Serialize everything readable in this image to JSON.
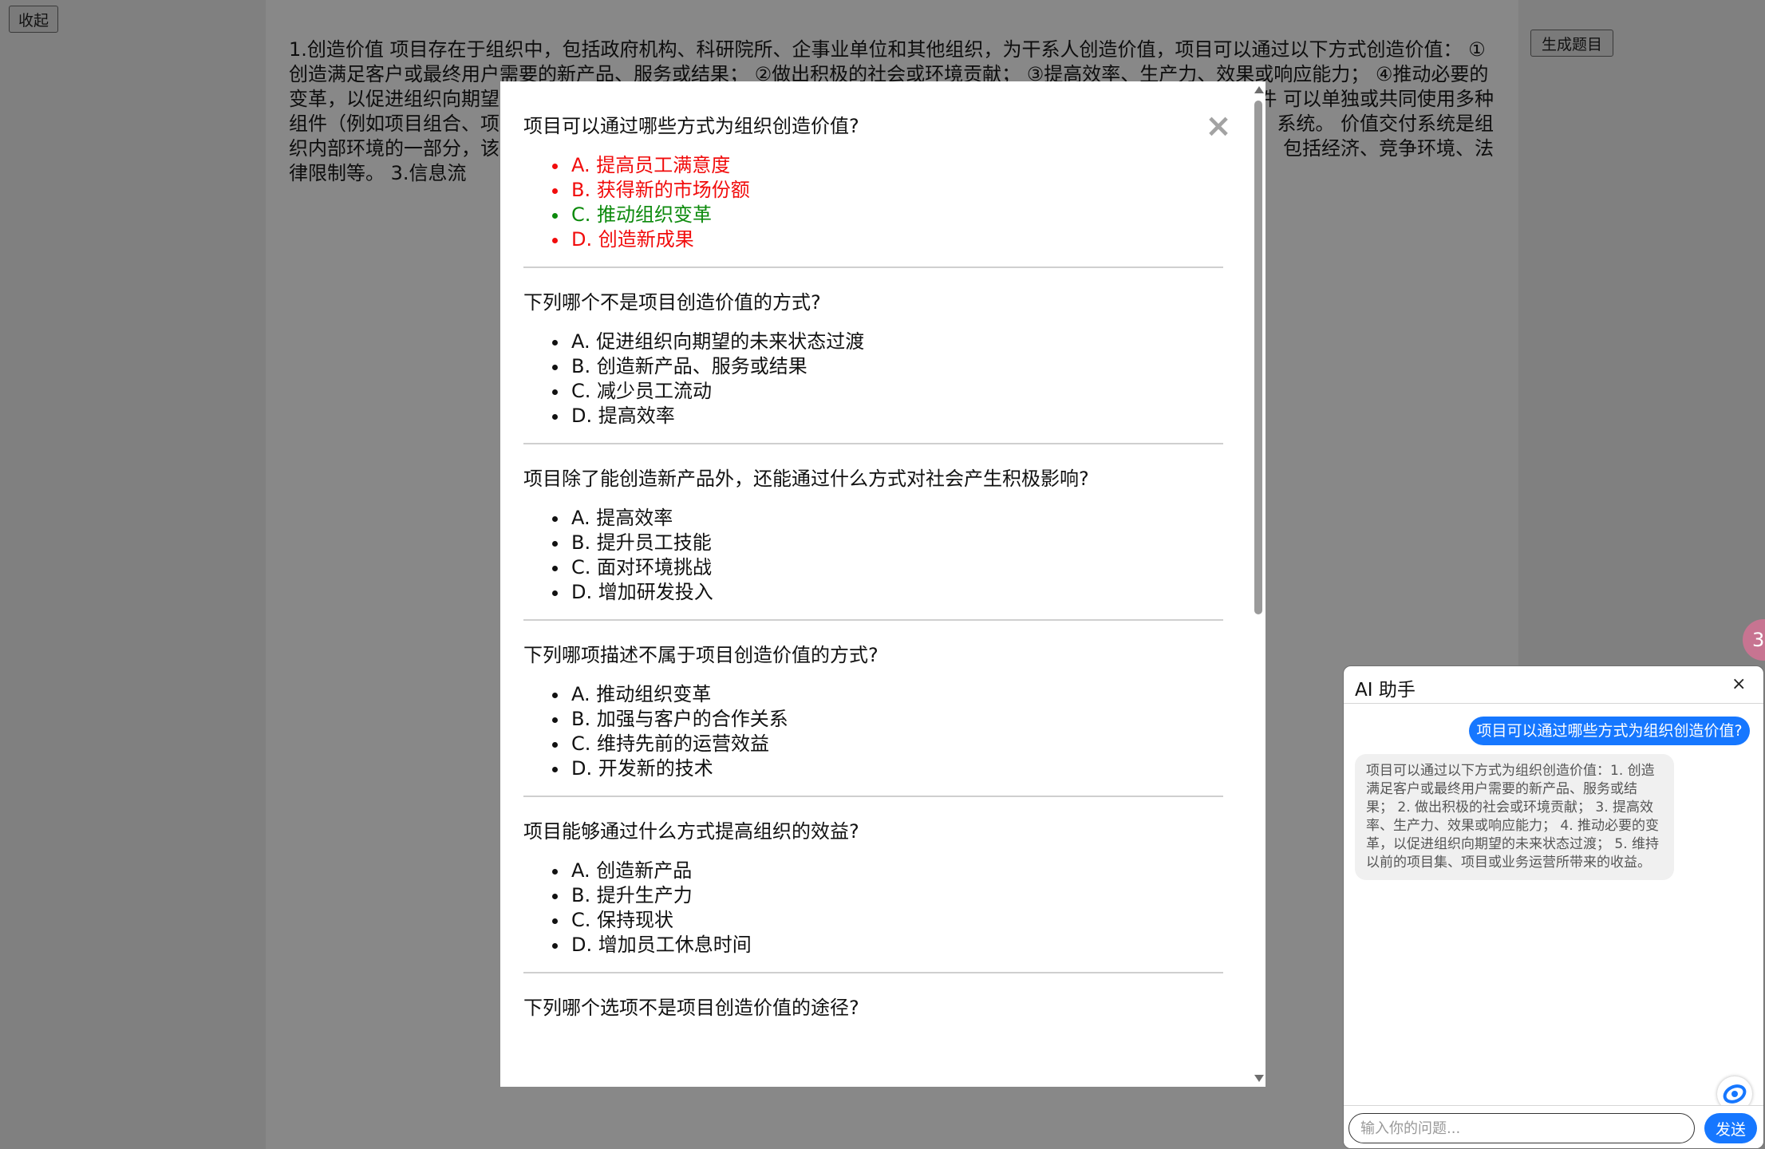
{
  "toolbar": {
    "collapse_label": "收起",
    "generate_label": "生成题目"
  },
  "source_text": "1.创造价值 项目存在于组织中，包括政府机构、科研院所、企事业单位和其他组织，为干系人创造价值，项目可以通过以下方式创造价值： ①创造满足客户或最终用户需要的新产品、服务或结果； ②做出积极的社会或环境贡献； ③提高效率、生产力、效果或响应能力； ④推动必要的变革，以促进组织向期望的未来状态过渡； ⑤维持以前的项目集、项目或业务运营所带来的收益。 2.价值交付系统 价值交付系统描述了项目如何在系统内运作，为组织及其干系人创造价值。价值交付包括项目如何创造价值、价值交付组件和信息流。 价值交付组件 可以单独或共同使用多种组件（例如项目组合、项目集、项目、产品和运营）创造价值，这些组件共同组成了一个符合组织战略的价值交付系统。 价值交付系统是组织内部环境的一部分，该环境受政策、程序、方法论、框架、治理结构等制约。该内部环境存在于更大的外部环境中，包括经济、竞争环境、法律限制等。 3.信息流",
  "source_visible_lines": [
    "1.创造价值 项目存在于组织中，包括政府机构、科研院所、企事业单位和其他组织，为干系人创造价值，项目可以通过以下方式创造价值： ①",
    "创造满足客户或最终用户需要的新产品、服务或结果； ②做出积极的社会或环境贡献； ③提高效率、生产力、效果或响应能力； ④推动必要的",
    "变革，以促进组织向期望",
    "件 可以单独或共同使用多种",
    "组件（例如项目组合、项",
    "系统。 价值交付系统是组",
    "织内部环境的一部分，该",
    "包括经济、竞争环境、法",
    "律限制等。 3.信息流"
  ],
  "modal": {
    "close_glyph": "×",
    "questions": [
      {
        "text": "项目可以通过哪些方式为组织创造价值?",
        "options": [
          {
            "label": "A. 提高员工满意度",
            "state": "wrong"
          },
          {
            "label": "B. 获得新的市场份额",
            "state": "wrong"
          },
          {
            "label": "C. 推动组织变革",
            "state": "right"
          },
          {
            "label": "D. 创造新成果",
            "state": "wrong"
          }
        ]
      },
      {
        "text": "下列哪个不是项目创造价值的方式?",
        "options": [
          {
            "label": "A. 促进组织向期望的未来状态过渡",
            "state": "none"
          },
          {
            "label": "B. 创造新产品、服务或结果",
            "state": "none"
          },
          {
            "label": "C. 减少员工流动",
            "state": "none"
          },
          {
            "label": "D. 提高效率",
            "state": "none"
          }
        ]
      },
      {
        "text": "项目除了能创造新产品外，还能通过什么方式对社会产生积极影响?",
        "options": [
          {
            "label": "A. 提高效率",
            "state": "none"
          },
          {
            "label": "B. 提升员工技能",
            "state": "none"
          },
          {
            "label": "C. 面对环境挑战",
            "state": "none"
          },
          {
            "label": "D. 增加研发投入",
            "state": "none"
          }
        ]
      },
      {
        "text": "下列哪项描述不属于项目创造价值的方式?",
        "options": [
          {
            "label": "A. 推动组织变革",
            "state": "none"
          },
          {
            "label": "B. 加强与客户的合作关系",
            "state": "none"
          },
          {
            "label": "C. 维持先前的运营效益",
            "state": "none"
          },
          {
            "label": "D. 开发新的技术",
            "state": "none"
          }
        ]
      },
      {
        "text": "项目能够通过什么方式提高组织的效益?",
        "options": [
          {
            "label": "A. 创造新产品",
            "state": "none"
          },
          {
            "label": "B. 提升生产力",
            "state": "none"
          },
          {
            "label": "C. 保持现状",
            "state": "none"
          },
          {
            "label": "D. 增加员工休息时间",
            "state": "none"
          }
        ]
      },
      {
        "text": "下列哪个选项不是项目创造价值的途径?",
        "options": []
      }
    ]
  },
  "ai_panel": {
    "title": "AI 助手",
    "close_glyph": "×",
    "user_message": "项目可以通过哪些方式为组织创造价值?",
    "bot_message": "项目可以通过以下方式为组织创造价值：1. 创造满足客户或最终用户需要的新产品、服务或结果； 2. 做出积极的社会或环境贡献； 3. 提高效率、生产力、效果或响应能力； 4. 推动必要的变革，以促进组织向期望的未来状态过渡； 5. 维持以前的项目集、项目或业务运营所带来的收益。",
    "input_placeholder": "输入你的问题...",
    "send_label": "发送"
  },
  "colors": {
    "wrong": "#f10c0c",
    "right": "#0c8a0c",
    "accent": "#1677ff"
  },
  "icons": {
    "chat_icon": "chat-assistant-icon",
    "side_bubble": "floating-bubble-icon"
  }
}
